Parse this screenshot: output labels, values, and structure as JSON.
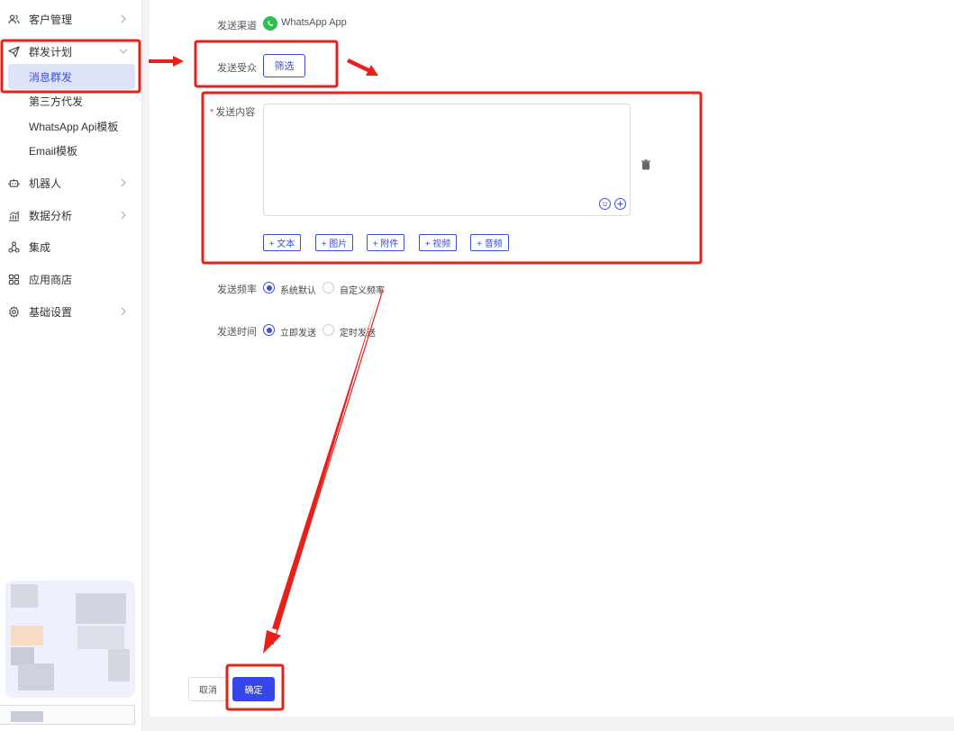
{
  "sidebar": {
    "items": [
      {
        "label": "客户管理",
        "icon": "users-icon",
        "has_chevron": true
      },
      {
        "label": "群发计划",
        "icon": "send-icon",
        "has_chevron": true,
        "expanded": true
      },
      {
        "label": "机器人",
        "icon": "robot-icon",
        "has_chevron": true
      },
      {
        "label": "数据分析",
        "icon": "chart-icon",
        "has_chevron": true
      },
      {
        "label": "集成",
        "icon": "integration-icon",
        "has_chevron": false
      },
      {
        "label": "应用商店",
        "icon": "apps-icon",
        "has_chevron": false
      },
      {
        "label": "基础设置",
        "icon": "settings-icon",
        "has_chevron": true
      }
    ],
    "subitems": [
      {
        "label": "消息群发",
        "active": true
      },
      {
        "label": "第三方代发",
        "active": false
      },
      {
        "label": "WhatsApp Api模板",
        "active": false
      },
      {
        "label": "Email模板",
        "active": false
      }
    ]
  },
  "form": {
    "channel_label": "发送渠道",
    "channel_value": "WhatsApp App",
    "audience_label": "发送受众",
    "filter_button": "筛选",
    "content_label": "发送内容",
    "content_value": "",
    "add_buttons": [
      "+ 文本",
      "+ 图片",
      "+ 附件",
      "+ 视频",
      "+ 音频"
    ],
    "frequency_label": "发送频率",
    "frequency_options": [
      {
        "label": "系统默认",
        "selected": true
      },
      {
        "label": "自定义频率",
        "selected": false
      }
    ],
    "time_label": "发送时间",
    "time_options": [
      {
        "label": "立即发送",
        "selected": true
      },
      {
        "label": "定时发送",
        "selected": false
      }
    ],
    "cancel_button": "取消",
    "confirm_button": "确定"
  },
  "colors": {
    "accent": "#3d4fd6",
    "primary_button": "#3646e8",
    "annotation": "#e8201a",
    "whatsapp": "#2fbf4f"
  }
}
